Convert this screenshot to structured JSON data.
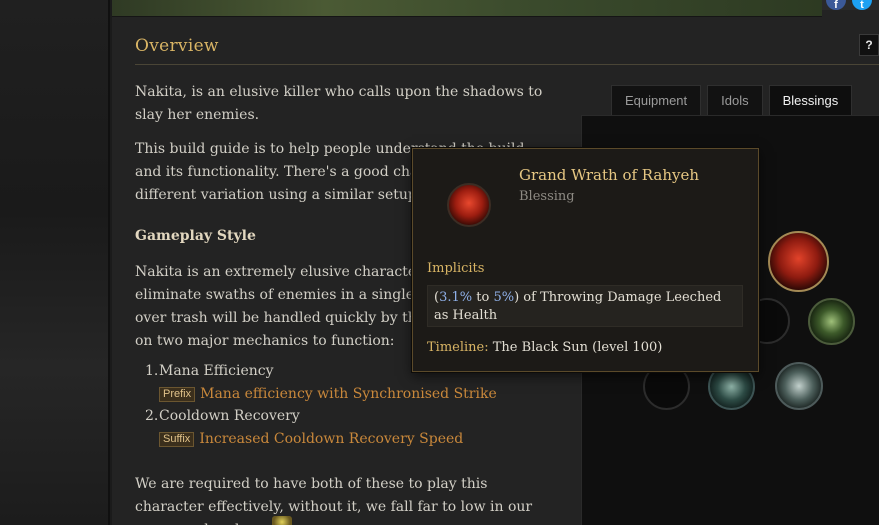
{
  "overview": {
    "title": "Overview",
    "help_label": "?"
  },
  "social": {
    "facebook": "f",
    "twitter": "t"
  },
  "paragraphs": {
    "p1": "Nakita, is an elusive killer who calls upon the shadows to slay her enemies.",
    "p2": "This build guide is to help people understand the build and its functionality. There's a good chance you can find a different variation using a similar setup.",
    "gameplay_heading": "Gameplay Style",
    "p3": "Nakita is an extremely elusive character who can eliminate swaths of enemies in a single strike. Moving over trash will be handled quickly by the skill. She relies on two major mechanics to function:",
    "p4": "We are required to have both of these to play this character effectively, without it, we fall far to low in our mana pool and"
  },
  "list": [
    {
      "num": "1.",
      "label": "Mana Efficiency",
      "tag": "Prefix",
      "link": "Mana efficiency with Synchronised Strike"
    },
    {
      "num": "2.",
      "label": "Cooldown Recovery",
      "tag": "Suffix",
      "link": "Increased Cooldown Recovery Speed"
    }
  ],
  "tabs": [
    {
      "label": "Equipment",
      "active": false
    },
    {
      "label": "Idols",
      "active": false
    },
    {
      "label": "Blessings",
      "active": true
    }
  ],
  "tooltip": {
    "name": "Grand Wrath of Rahyeh",
    "type": "Blessing",
    "implicits_label": "Implicits",
    "mod_range_low": "3.1%",
    "mod_to": "to",
    "mod_range_high": "5%",
    "mod_text": "of Throwing Damage Leeched as Health",
    "timeline_label": "Timeline:",
    "timeline_value": "The Black Sun (level 100)"
  },
  "colors": {
    "accent_gold": "#d9b565",
    "link_orange": "#c9883b",
    "range_blue": "#8fb0e8"
  }
}
